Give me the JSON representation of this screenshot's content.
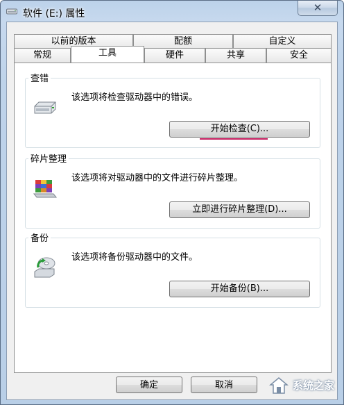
{
  "window": {
    "title": "软件 (E:) 属性",
    "close_glyph": "✕"
  },
  "tabs": {
    "row1": [
      "以前的版本",
      "配额",
      "自定义"
    ],
    "row2": [
      "常规",
      "工具",
      "硬件",
      "共享",
      "安全"
    ],
    "active": "工具"
  },
  "groups": [
    {
      "label": "查错",
      "description": "该选项将检查驱动器中的错误。",
      "button": "开始检查(C)...",
      "icon": "drive-icon"
    },
    {
      "label": "碎片整理",
      "description": "该选项将对驱动器中的文件进行碎片整理。",
      "button": "立即进行碎片整理(D)...",
      "icon": "defrag-icon"
    },
    {
      "label": "备份",
      "description": "该选项将备份驱动器中的文件。",
      "button": "开始备份(B)...",
      "icon": "backup-icon"
    }
  ],
  "footer": {
    "ok": "确定",
    "cancel": "取消"
  },
  "watermark": {
    "text": "系统之家"
  },
  "colors": {
    "highlight_underline": "#c2185b"
  }
}
